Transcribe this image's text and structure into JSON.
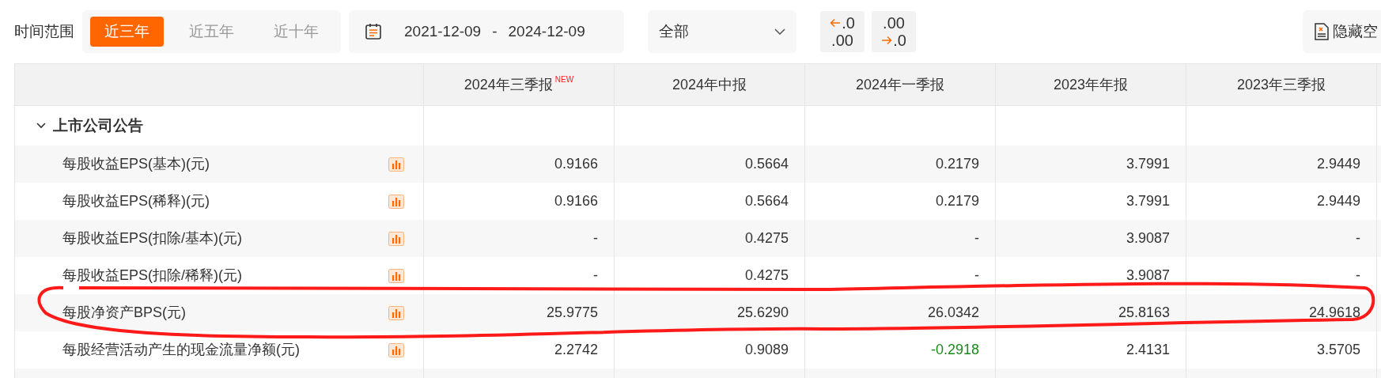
{
  "filter": {
    "label": "时间范围",
    "ranges": [
      {
        "label": "近三年",
        "selected": true
      },
      {
        "label": "近五年",
        "selected": false
      },
      {
        "label": "近十年",
        "selected": false
      }
    ],
    "date_start": "2021-12-09",
    "date_sep": "-",
    "date_end": "2024-12-09",
    "type_select": "全部",
    "decimal_buttons": [
      {
        "kind": "decrease",
        "top": ".0",
        "bottom": ".00"
      },
      {
        "kind": "increase",
        "top": ".00",
        "bottom": ".0"
      }
    ],
    "hide_button": "隐藏空"
  },
  "table": {
    "columns": [
      {
        "label": "2024年三季报",
        "badge": "NEW"
      },
      {
        "label": "2024年中报"
      },
      {
        "label": "2024年一季报"
      },
      {
        "label": "2023年年报"
      },
      {
        "label": "2023年三季报"
      }
    ],
    "section": {
      "label": "上市公司公告",
      "expanded": true
    },
    "rows": [
      {
        "label": "每股收益EPS(基本)(元)",
        "cells": [
          {
            "text": "0.9166",
            "down": false
          },
          {
            "text": "0.5664",
            "down": false
          },
          {
            "text": "0.2179",
            "down": false
          },
          {
            "text": "3.7991",
            "down": false
          },
          {
            "text": "2.9449",
            "down": false
          }
        ]
      },
      {
        "label": "每股收益EPS(稀释)(元)",
        "cells": [
          {
            "text": "0.9166",
            "down": false
          },
          {
            "text": "0.5664",
            "down": false
          },
          {
            "text": "0.2179",
            "down": false
          },
          {
            "text": "3.7991",
            "down": false
          },
          {
            "text": "2.9449",
            "down": false
          }
        ]
      },
      {
        "label": "每股收益EPS(扣除/基本)(元)",
        "cells": [
          {
            "text": "-",
            "down": false
          },
          {
            "text": "0.4275",
            "down": false
          },
          {
            "text": "-",
            "down": false
          },
          {
            "text": "3.9087",
            "down": false
          },
          {
            "text": "-",
            "down": false
          }
        ]
      },
      {
        "label": "每股收益EPS(扣除/稀释)(元)",
        "cells": [
          {
            "text": "-",
            "down": false
          },
          {
            "text": "0.4275",
            "down": false
          },
          {
            "text": "-",
            "down": false
          },
          {
            "text": "3.9087",
            "down": false
          },
          {
            "text": "-",
            "down": false
          }
        ]
      },
      {
        "label": "每股净资产BPS(元)",
        "cells": [
          {
            "text": "25.9775",
            "down": false
          },
          {
            "text": "25.6290",
            "down": false
          },
          {
            "text": "26.0342",
            "down": false
          },
          {
            "text": "25.8163",
            "down": false
          },
          {
            "text": "24.9618",
            "down": false
          }
        ]
      },
      {
        "label": "每股经营活动产生的现金流量净额(元)",
        "cells": [
          {
            "text": "2.2742",
            "down": false
          },
          {
            "text": "0.9089",
            "down": false
          },
          {
            "text": "-0.2918",
            "down": true
          },
          {
            "text": "2.4131",
            "down": false
          },
          {
            "text": "3.5705",
            "down": false
          }
        ]
      }
    ]
  }
}
